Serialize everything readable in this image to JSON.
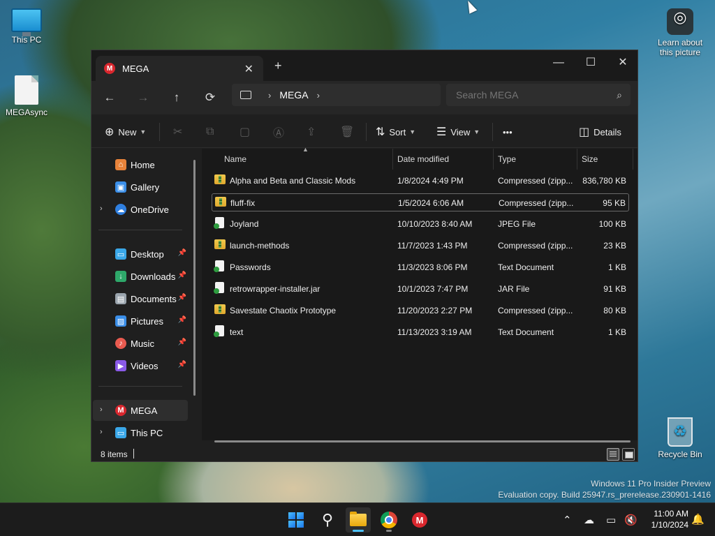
{
  "desktop": {
    "icons": [
      {
        "label": "This PC"
      },
      {
        "label": "MEGAsync"
      },
      {
        "label": "Learn about this picture"
      },
      {
        "label": "Recycle Bin"
      }
    ],
    "watermark_line1": "Windows 11 Pro Insider Preview",
    "watermark_line2": "Evaluation copy. Build 25947.rs_prerelease.230901-1416"
  },
  "window": {
    "tab_title": "MEGA",
    "tab_close": "✕",
    "new_tab": "+",
    "controls": {
      "minimize": "—",
      "maximize": "☐",
      "close": "✕"
    },
    "nav": {
      "back": "←",
      "forward": "→",
      "up": "↑",
      "refresh": "⟳"
    },
    "address": {
      "chevron1": "›",
      "location": "MEGA",
      "chevron2": "›"
    },
    "search_placeholder": "Search MEGA",
    "search_icon": "⌕",
    "toolbar": {
      "new_label": "New",
      "sort_label": "Sort",
      "view_label": "View",
      "more_label": "•••",
      "details_label": "Details"
    },
    "sidebar": {
      "items": [
        {
          "label": "Home",
          "icon": "home-icon",
          "color": "#e8833a"
        },
        {
          "label": "Gallery",
          "icon": "gallery-icon",
          "color": "#3a8ee8"
        },
        {
          "label": "OneDrive",
          "icon": "onedrive-icon",
          "color": "#2f7fe0",
          "expander": "›"
        },
        {
          "label": "Desktop",
          "icon": "desktop-icon",
          "color": "#3aa7e8",
          "pinned": true
        },
        {
          "label": "Downloads",
          "icon": "downloads-icon",
          "color": "#2ea86a",
          "pinned": true
        },
        {
          "label": "Documents",
          "icon": "documents-icon",
          "color": "#9aa4ad",
          "pinned": true
        },
        {
          "label": "Pictures",
          "icon": "pictures-icon",
          "color": "#3a8ee8",
          "pinned": true
        },
        {
          "label": "Music",
          "icon": "music-icon",
          "color": "#e85a4f",
          "pinned": true
        },
        {
          "label": "Videos",
          "icon": "videos-icon",
          "color": "#8a5ae8",
          "pinned": true
        },
        {
          "label": "MEGA",
          "icon": "mega-icon",
          "color": "#d9272e",
          "expander": "›",
          "selected": true
        },
        {
          "label": "This PC",
          "icon": "this-pc-icon",
          "color": "#3aa7e8",
          "expander": "›"
        }
      ]
    },
    "columns": [
      "Name",
      "Date modified",
      "Type",
      "Size"
    ],
    "files": [
      {
        "name": "Alpha and Beta and Classic Mods",
        "date": "1/8/2024 4:49 PM",
        "type": "Compressed (zipp...",
        "size": "836,780 KB",
        "kind": "zip"
      },
      {
        "name": "fluff-fix",
        "date": "1/5/2024 6:06 AM",
        "type": "Compressed (zipp...",
        "size": "95 KB",
        "kind": "zip"
      },
      {
        "name": "Joyland",
        "date": "10/10/2023 8:40 AM",
        "type": "JPEG File",
        "size": "100 KB",
        "kind": "doc"
      },
      {
        "name": "launch-methods",
        "date": "11/7/2023 1:43 PM",
        "type": "Compressed (zipp...",
        "size": "23 KB",
        "kind": "zip"
      },
      {
        "name": "Passwords",
        "date": "11/3/2023 8:06 PM",
        "type": "Text Document",
        "size": "1 KB",
        "kind": "doc"
      },
      {
        "name": "retrowrapper-installer.jar",
        "date": "10/1/2023 7:47 PM",
        "type": "JAR File",
        "size": "91 KB",
        "kind": "doc"
      },
      {
        "name": "Savestate Chaotix Prototype",
        "date": "11/20/2023 2:27 PM",
        "type": "Compressed (zipp...",
        "size": "80 KB",
        "kind": "zip"
      },
      {
        "name": "text",
        "date": "11/13/2023 3:19 AM",
        "type": "Text Document",
        "size": "1 KB",
        "kind": "doc"
      }
    ],
    "status_count": "8 items"
  },
  "taskbar": {
    "apps": [
      {
        "name": "start-button",
        "icon": "windows-logo-icon"
      },
      {
        "name": "search-button",
        "icon": "search-icon"
      },
      {
        "name": "file-explorer-app",
        "icon": "folder-icon",
        "active": true
      },
      {
        "name": "chrome-app",
        "icon": "chrome-icon"
      },
      {
        "name": "mega-app",
        "icon": "mega-icon"
      }
    ],
    "clock_time": "11:00 AM",
    "clock_date": "1/10/2024",
    "accent": "#4cc2ff"
  }
}
